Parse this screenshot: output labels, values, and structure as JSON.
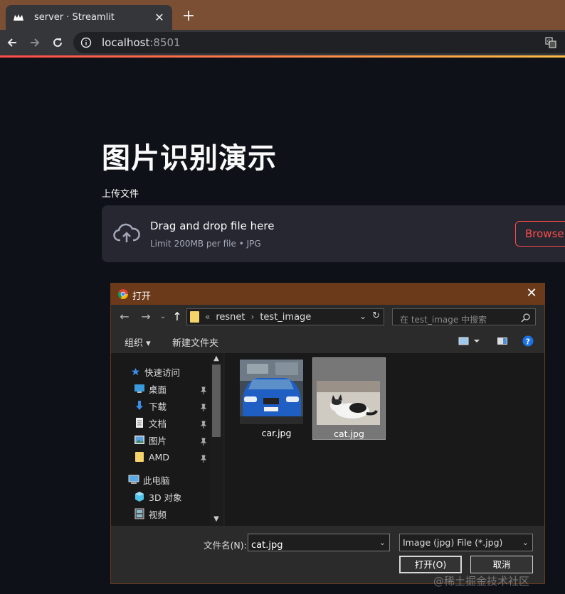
{
  "browser": {
    "tab_title": "server · Streamlit",
    "new_tab": "+",
    "tab_close": "✕",
    "url_host": "localhost",
    "url_port": ":8501"
  },
  "app": {
    "title": "图片识别演示",
    "upload_label": "上传文件",
    "dropzone_title": "Drag and drop file here",
    "dropzone_limit": "Limit 200MB per file • JPG",
    "browse_label": "Browse files",
    "accent_color": "#ff4b4b"
  },
  "dialog": {
    "title": "打开",
    "close": "✕",
    "breadcrumb": [
      "resnet",
      "test_image"
    ],
    "breadcrumb_prefix": "«",
    "search_placeholder": "在 test_image 中搜索",
    "organize_label": "组织 ▾",
    "new_folder_label": "新建文件夹",
    "nav_items": [
      {
        "label": "快速访问",
        "icon": "star-icon",
        "pinned": false
      },
      {
        "label": "桌面",
        "icon": "desktop-icon",
        "pinned": true
      },
      {
        "label": "下载",
        "icon": "download-icon",
        "pinned": true
      },
      {
        "label": "文档",
        "icon": "document-icon",
        "pinned": true
      },
      {
        "label": "图片",
        "icon": "pictures-icon",
        "pinned": true
      },
      {
        "label": "AMD",
        "icon": "folder-icon",
        "pinned": true
      },
      {
        "label": "此电脑",
        "icon": "computer-icon",
        "pinned": false
      },
      {
        "label": "3D 对象",
        "icon": "3d-objects-icon",
        "pinned": false
      },
      {
        "label": "视频",
        "icon": "video-icon",
        "pinned": false
      }
    ],
    "files": [
      {
        "name": "car.jpg",
        "selected": false
      },
      {
        "name": "cat.jpg",
        "selected": true
      }
    ],
    "filename_label": "文件名(N):",
    "filename_value": "cat.jpg",
    "filetype_value": "Image (jpg) File (*.jpg)",
    "open_button": "打开(O)",
    "cancel_button": "取消"
  },
  "watermark": "@稀土掘金技术社区"
}
